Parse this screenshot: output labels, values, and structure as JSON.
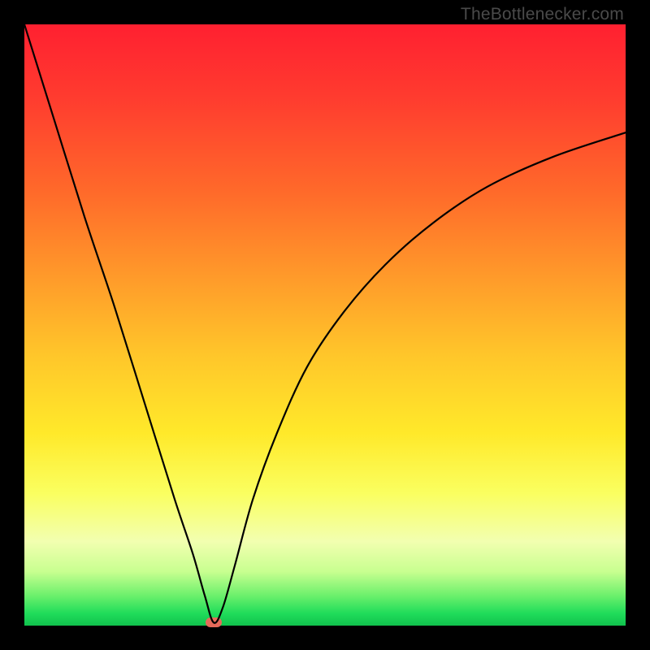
{
  "watermark": "TheBottlenecker.com",
  "chart_data": {
    "type": "line",
    "title": "",
    "xlabel": "",
    "ylabel": "",
    "xlim": [
      0,
      100
    ],
    "ylim": [
      0,
      100
    ],
    "x": [
      0,
      5,
      10,
      15,
      20,
      25,
      28,
      30,
      31.5,
      33,
      35,
      38,
      42,
      47,
      53,
      60,
      68,
      77,
      88,
      100
    ],
    "values": [
      100,
      84,
      68,
      53,
      37,
      21,
      12,
      5,
      0.5,
      3,
      10,
      21,
      32,
      43,
      52,
      60,
      67,
      73,
      78,
      82
    ],
    "min_x": 31.5,
    "min_y": 0.5,
    "colors": {
      "curve": "#000000",
      "min_marker": "#e66a5a",
      "bg_top": "#ff2030",
      "bg_bottom": "#11c24d"
    }
  }
}
